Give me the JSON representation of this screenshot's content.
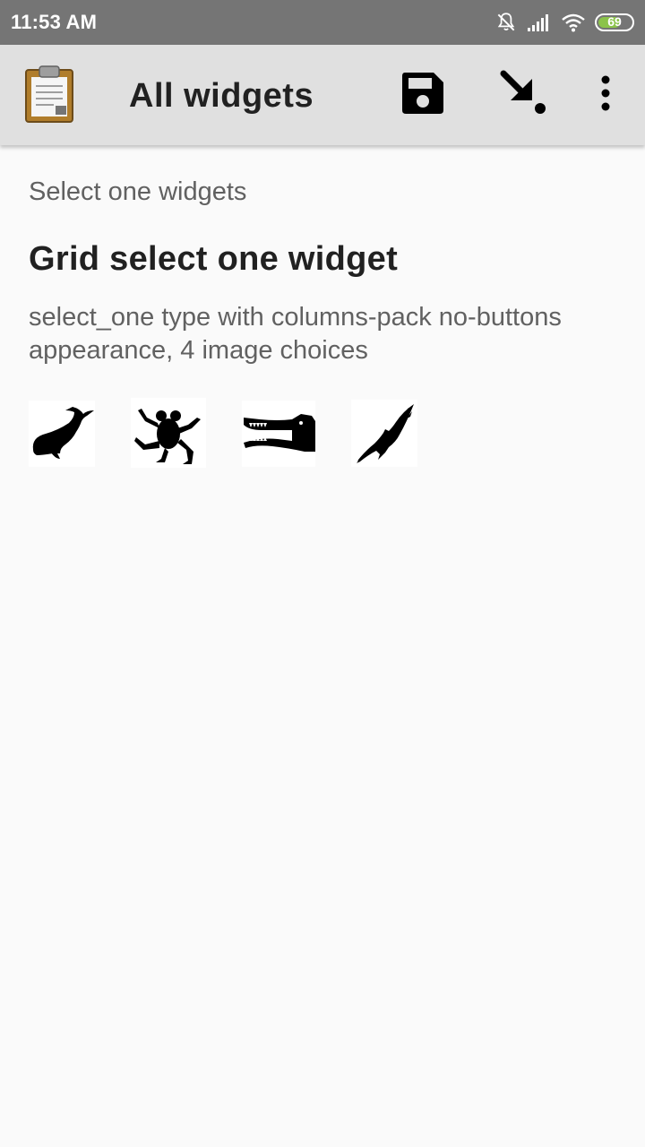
{
  "status_bar": {
    "time": "11:53 AM",
    "battery_level": "69",
    "battery_color": "#8bc34a",
    "icons": [
      "notifications-muted-icon",
      "signal-icon",
      "wifi-icon",
      "battery-icon"
    ]
  },
  "app_bar": {
    "title": "All widgets",
    "logo_icon": "clipboard-icon",
    "actions": [
      "save-icon",
      "go-to-icon",
      "more-vert-icon"
    ]
  },
  "form": {
    "group_label": "Select one widgets",
    "question": {
      "label": "Grid select one widget",
      "hint": "select_one type with columns-pack no-buttons appearance, 4 image choices",
      "choices": [
        {
          "icon": "whale-icon"
        },
        {
          "icon": "frog-icon"
        },
        {
          "icon": "crocodile-icon"
        },
        {
          "icon": "eagle-icon"
        }
      ]
    }
  },
  "colors": {
    "status_bar": "#757575",
    "app_bar": "#e0e0e0",
    "background": "#fafafa"
  }
}
